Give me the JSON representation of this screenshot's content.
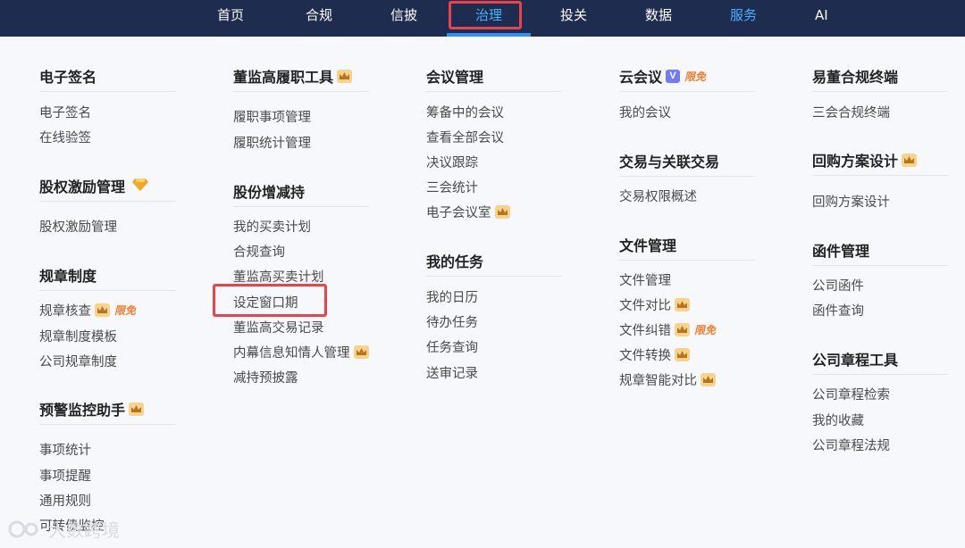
{
  "nav": {
    "items": [
      "首页",
      "合规",
      "信披",
      "治理",
      "投关",
      "数据",
      "服务",
      "AI"
    ],
    "active": "治理"
  },
  "columns": {
    "c1": {
      "s1": {
        "title": "电子签名",
        "links": [
          "电子签名",
          "在线验签"
        ]
      },
      "s2": {
        "title": "股权激励管理",
        "links": [
          "股权激励管理"
        ]
      },
      "s3": {
        "title": "规章制度",
        "links": [
          "规章核查",
          "规章制度模板",
          "公司规章制度"
        ],
        "free": "限免"
      },
      "s4": {
        "title": "预警监控助手",
        "links": [
          "事项统计",
          "事项提醒",
          "通用规则",
          "可转债监控"
        ]
      }
    },
    "c2": {
      "s1": {
        "title": "董监高履职工具",
        "links": [
          "履职事项管理",
          "履职统计管理"
        ]
      },
      "s2": {
        "title": "股份增减持",
        "links": [
          "我的买卖计划",
          "合规查询",
          "董监高买卖计划",
          "设定窗口期",
          "董监高交易记录",
          "内幕信息知情人管理",
          "减持预披露"
        ]
      }
    },
    "c3": {
      "s1": {
        "title": "会议管理",
        "links": [
          "筹备中的会议",
          "查看全部会议",
          "决议跟踪",
          "三会统计",
          "电子会议室"
        ]
      },
      "s2": {
        "title": "我的任务",
        "links": [
          "我的日历",
          "待办任务",
          "任务查询",
          "送审记录"
        ]
      }
    },
    "c4": {
      "s1": {
        "title": "云会议",
        "badge": "V",
        "free": "限免",
        "links": [
          "我的会议"
        ]
      },
      "s2": {
        "title": "交易与关联交易",
        "links": [
          "交易权限概述"
        ]
      },
      "s3": {
        "title": "文件管理",
        "links": [
          "文件管理",
          "文件对比",
          "文件纠错",
          "文件转换",
          "规章智能对比"
        ],
        "free": "限免"
      }
    },
    "c5": {
      "s1": {
        "title": "易董合规终端",
        "links": [
          "三会合规终端"
        ]
      },
      "s2": {
        "title": "回购方案设计",
        "links": [
          "回购方案设计"
        ]
      },
      "s3": {
        "title": "函件管理",
        "links": [
          "公司函件",
          "函件查询"
        ]
      },
      "s4": {
        "title": "公司章程工具",
        "links": [
          "公司章程检索",
          "我的收藏",
          "公司章程法规"
        ]
      }
    }
  },
  "watermark": "大数跨境",
  "colors": {
    "nav_bg": "#1d2c4f",
    "accent": "#49b2ff",
    "highlight": "#e9434b",
    "crown": "#f7d38c",
    "free": "#ff7a2b"
  }
}
